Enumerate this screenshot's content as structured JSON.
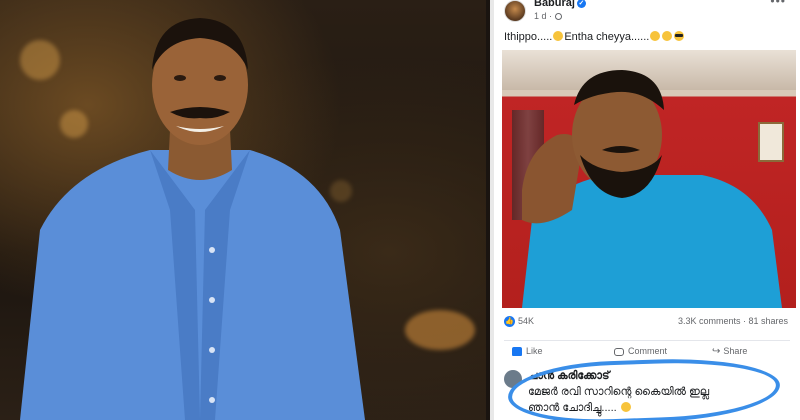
{
  "post": {
    "author": "Baburaj",
    "time": "1 d",
    "text_line": "Ithippo.....",
    "text_line2": "Entha cheyya......",
    "reactions_count": "54K",
    "comments_count": "3.3K comments",
    "shares_count": "81 shares",
    "like_label": "Like",
    "comment_label": "Comment",
    "share_label": "Share",
    "more": "•••"
  },
  "comment": {
    "author": "ചാൻ കരിക്കോട്",
    "line1": "മേജർ രവി സാറിന്റെ കൈയിൽ ഇല്ല",
    "line2": "ഞാൻ ചോദിച്ചു....."
  },
  "colors": {
    "facebook_blue": "#1877f2",
    "highlight_ring": "#3a8ee8",
    "wall_red": "#c02525"
  },
  "icons": [
    "verified-badge-icon",
    "globe-icon",
    "more-icon",
    "like-reaction-icon",
    "thumb-up-icon",
    "comment-icon",
    "share-icon"
  ]
}
